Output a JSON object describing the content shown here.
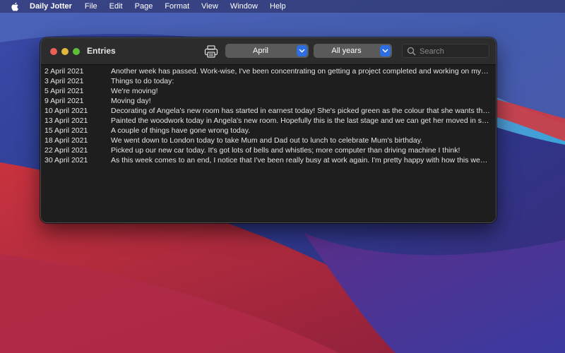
{
  "menubar": {
    "app_name": "Daily Jotter",
    "items": [
      "File",
      "Edit",
      "Page",
      "Format",
      "View",
      "Window",
      "Help"
    ]
  },
  "window": {
    "title": "Entries",
    "month_selector": {
      "selected": "April"
    },
    "year_selector": {
      "selected": "All years"
    },
    "search": {
      "placeholder": "Search",
      "value": ""
    }
  },
  "entries": [
    {
      "date": "2 April 2021",
      "text": "Another week has passed. Work-wise, I've been concentrating on getting a project completed and working on my proce..."
    },
    {
      "date": "3 April 2021",
      "text": "Things to do today:"
    },
    {
      "date": "5 April 2021",
      "text": "We're moving!"
    },
    {
      "date": "9 April 2021",
      "text": "Moving day!"
    },
    {
      "date": "10 April 2021",
      "text": "Decorating of Angela's new room has started in earnest today! She's picked green as the colour that she wants the walls."
    },
    {
      "date": "13 April 2021",
      "text": "Painted the woodwork today in Angela's new room. Hopefully this is the last stage and we can get her moved in soon! W..."
    },
    {
      "date": "15 April 2021",
      "text": "A couple of things have gone wrong today."
    },
    {
      "date": "18 April 2021",
      "text": "We went down to London today to take Mum and Dad out to lunch to celebrate Mum's birthday."
    },
    {
      "date": "22 April 2021",
      "text": "Picked up our new car today. It's got lots of bells and whistles; more computer than driving machine I think!"
    },
    {
      "date": "30 April 2021",
      "text": "As this week comes to an end, I notice that I've been really busy at work again. I'm pretty happy with how this week has..."
    }
  ],
  "icons": {
    "apple": "apple-logo-icon",
    "print": "printer-icon",
    "chevron": "chevron-down-icon",
    "search": "magnifying-glass-icon"
  },
  "colors": {
    "window_bg": "#1e1e1e",
    "titlebar_bg": "#2c2c2c",
    "accent": "#2f6ee0",
    "close": "#ec5f57",
    "minimize": "#e0b83e",
    "maximize": "#5fc038"
  }
}
